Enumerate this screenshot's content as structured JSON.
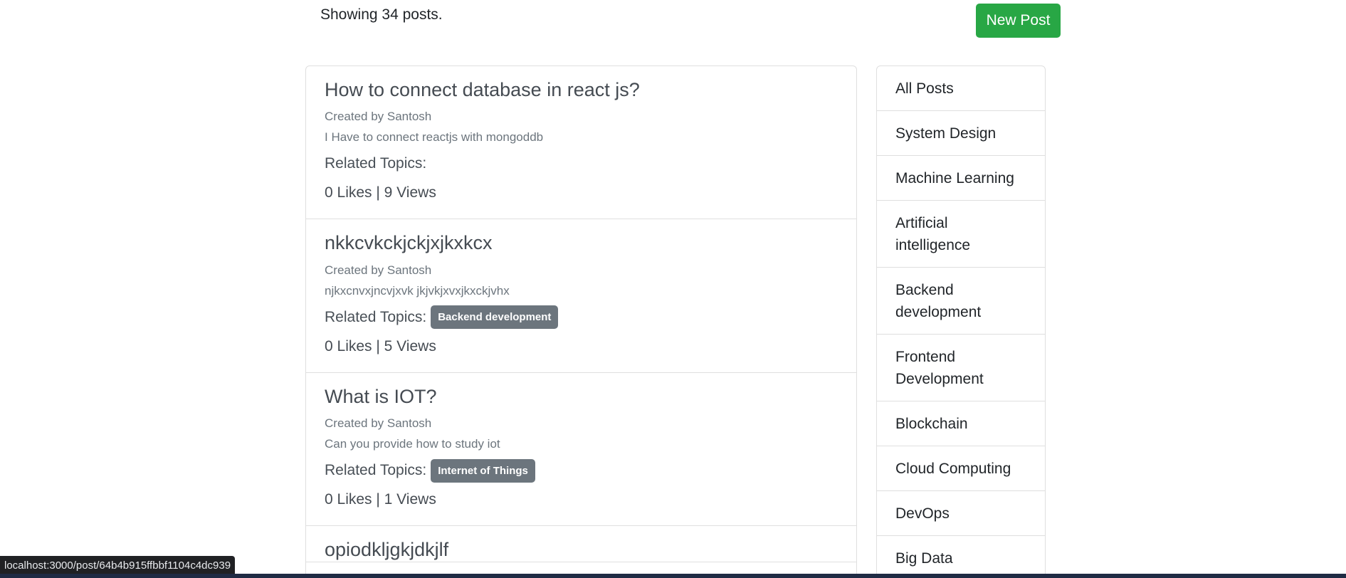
{
  "header": {
    "showing_text": "Showing 34 posts.",
    "new_post_label": "New Post"
  },
  "posts": [
    {
      "title": "How to connect database in react js?",
      "author": "Created by Santosh",
      "description": "I Have to connect reactjs with mongoddb",
      "topics_label": "Related Topics:",
      "topics": [],
      "stats": "0 Likes | 9 Views"
    },
    {
      "title": "nkkcvkckjckjxjkxkcx",
      "author": "Created by Santosh",
      "description": "njkxcnvxjncvjxvk jkjvkjxvxjkxckjvhx",
      "topics_label": "Related Topics:",
      "topics": [
        "Backend development"
      ],
      "stats": "0 Likes | 5 Views"
    },
    {
      "title": "What is IOT?",
      "author": "Created by Santosh",
      "description": "Can you provide how to study iot",
      "topics_label": "Related Topics:",
      "topics": [
        "Internet of Things"
      ],
      "stats": "0 Likes | 1 Views"
    },
    {
      "title": "opiodkljgkjdkjlf",
      "author": "",
      "description": "",
      "topics_label": "",
      "topics": [],
      "stats": ""
    }
  ],
  "sidebar": {
    "items": [
      {
        "label": "All Posts",
        "lines": 1
      },
      {
        "label": "System Design",
        "lines": 1
      },
      {
        "label": "Machine Learning",
        "lines": 1
      },
      {
        "label": "Artificial intelligence",
        "lines": 2
      },
      {
        "label": "Backend development",
        "lines": 2
      },
      {
        "label": "Frontend Development",
        "lines": 2
      },
      {
        "label": "Blockchain",
        "lines": 1
      },
      {
        "label": "Cloud Computing",
        "lines": 1
      },
      {
        "label": "DevOps",
        "lines": 1
      },
      {
        "label": "Big Data",
        "lines": 1
      }
    ]
  },
  "status_bar": {
    "url": "localhost:3000/post/64b4b915ffbbf1104c4dc939"
  },
  "colors": {
    "accent_green": "#28a745",
    "badge_gray": "#6c757d"
  }
}
